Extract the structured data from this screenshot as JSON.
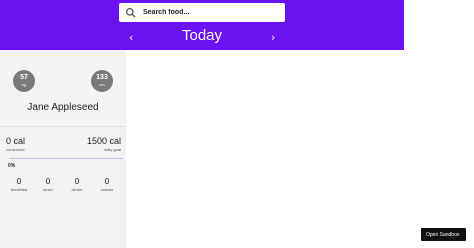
{
  "header": {
    "search": {
      "placeholder": "Search food...",
      "value": ""
    },
    "date_title": "Today",
    "prev_icon": "chevron-left",
    "next_icon": "chevron-right",
    "accent_color": "#6a12f0"
  },
  "profile": {
    "weight": {
      "value": "57",
      "unit": "kg"
    },
    "height": {
      "value": "133",
      "unit": "cm"
    },
    "name": "Jane Appleseed"
  },
  "goals": {
    "consumed_value": "0 cal",
    "consumed_label": "consumed",
    "goal_value": "1500 cal",
    "goal_label": "daily goal",
    "progress_percent": 0,
    "progress_text": "0%",
    "meals": [
      {
        "value": "0",
        "label": "breakfast"
      },
      {
        "value": "0",
        "label": "lunch"
      },
      {
        "value": "0",
        "label": "dinner"
      },
      {
        "value": "0",
        "label": "snacks"
      }
    ]
  },
  "sandbox_button": "Open Sandbox"
}
